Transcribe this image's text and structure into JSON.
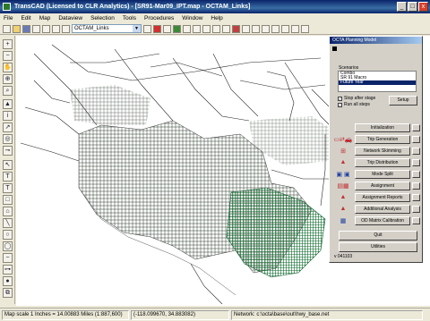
{
  "window": {
    "title": "TransCAD (Licensed to CLR Analytics) - [SR91-Mar09_IPT.map - OCTAM_Links]",
    "controls": [
      "_",
      "□",
      "x"
    ]
  },
  "menu": [
    "File",
    "Edit",
    "Map",
    "Dataview",
    "Selection",
    "Tools",
    "Procedures",
    "Window",
    "Help"
  ],
  "toolbar": {
    "layer": "OCTAM_Links"
  },
  "panel": {
    "title": "OCTA Planning Model",
    "scenarios_label": "Scenarios",
    "scenarios": [
      "Combo",
      "SR 91 Macro",
      "Future Year"
    ],
    "selected_scenario": "Future Year",
    "stop_after_stage": "Stop after stage",
    "run_all_steps": "Run all steps",
    "setup": "Setup",
    "steps": [
      {
        "label": "Initialization",
        "icon": "init-icon"
      },
      {
        "label": "Trip Generation",
        "icon": "trip-generation-icon"
      },
      {
        "label": "Network Skimming",
        "icon": "network-skimming-icon"
      },
      {
        "label": "Trip Distribution",
        "icon": "trip-distribution-icon"
      },
      {
        "label": "Mode Split",
        "icon": "mode-split-icon"
      },
      {
        "label": "Assignment",
        "icon": "assignment-icon"
      },
      {
        "label": "Assignment Reports",
        "icon": "assignment-reports-icon"
      },
      {
        "label": "Additional Analysis",
        "icon": "additional-analysis-icon"
      },
      {
        "label": "OD Matrix Calibration",
        "icon": "od-matrix-icon"
      }
    ],
    "quit": "Quit",
    "utilities": "Utilities",
    "version": "v 041103"
  },
  "status": {
    "scale": "Map scale 1 Inches = 14.00883 Miles (1:887,600)",
    "coords": "(-118.099670, 34.883082)",
    "network": "Network: c:\\octa\\base\\out\\hwy_base.net"
  }
}
